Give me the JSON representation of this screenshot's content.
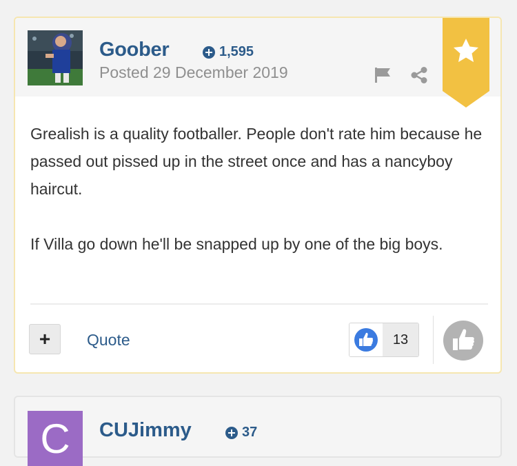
{
  "post": {
    "author": "Goober",
    "reputation": "1,595",
    "posted": "Posted 29 December 2019",
    "body": [
      "Grealish is a quality footballer. People don't rate him because he passed out pissed up in the street once and has a nancyboy haircut.",
      "If Villa go down he'll be snapped up by one of the big boys."
    ],
    "multiquote_label": "+",
    "quote_label": "Quote",
    "reaction_count": "13",
    "icons": {
      "rep": "plus-circle-icon",
      "flag": "flag-icon",
      "share": "share-icon",
      "ribbon": "star-ribbon-icon",
      "reaction": "thumbs-up-icon",
      "react": "thumbs-up-icon"
    },
    "colors": {
      "accent": "#2c5b8a",
      "ribbon": "#f2c142",
      "reaction_blue": "#3b7be0",
      "react_grey": "#b3b3b3"
    }
  },
  "next_post": {
    "avatar_letter": "C",
    "author": "CUJimmy",
    "reputation": "37",
    "colors": {
      "avatar": "#9b6bc5"
    }
  }
}
